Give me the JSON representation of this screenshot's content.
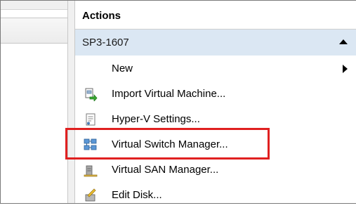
{
  "actions_pane": {
    "header": "Actions",
    "group_title": "SP3-1607",
    "items": [
      {
        "label": "New",
        "icon": "",
        "has_submenu": true
      },
      {
        "label": "Import Virtual Machine...",
        "icon": "import-vm-icon"
      },
      {
        "label": "Hyper-V Settings...",
        "icon": "settings-document-icon"
      },
      {
        "label": "Virtual Switch Manager...",
        "icon": "network-switch-icon"
      },
      {
        "label": "Virtual SAN Manager...",
        "icon": "san-storage-icon"
      },
      {
        "label": "Edit Disk...",
        "icon": "edit-disk-icon"
      }
    ]
  },
  "annotation": {
    "color": "#e02020",
    "target": "Virtual Switch Manager..."
  },
  "colors": {
    "group_header_bg": "#dbe7f3"
  }
}
